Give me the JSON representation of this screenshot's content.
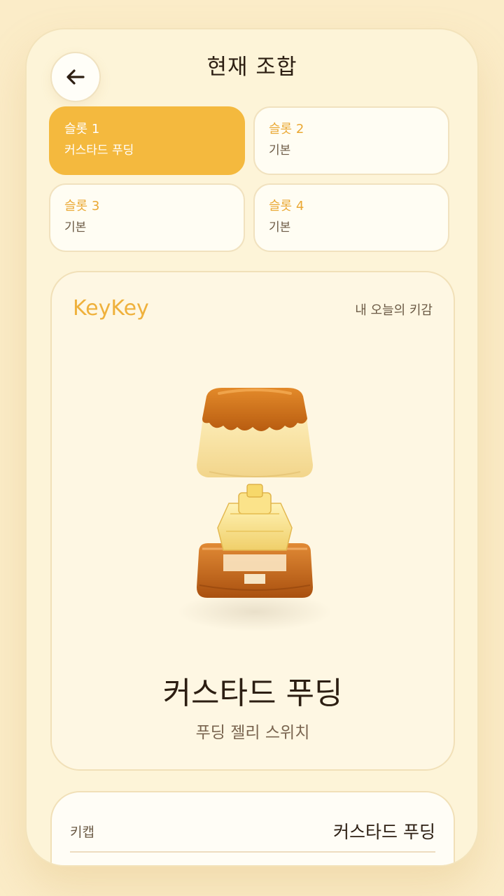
{
  "header": {
    "title": "현재 조합",
    "back_icon": "arrow-left-icon"
  },
  "slots": [
    {
      "name": "슬롯 1",
      "value": "커스타드 푸딩",
      "active": true
    },
    {
      "name": "슬롯 2",
      "value": "기본",
      "active": false
    },
    {
      "name": "슬롯 3",
      "value": "기본",
      "active": false
    },
    {
      "name": "슬롯 4",
      "value": "기본",
      "active": false
    }
  ],
  "combo": {
    "brand": "KeyKey",
    "mood": "내 오늘의 키감",
    "illustration": "pudding-keycap-switch-icon",
    "name": "커스타드 푸딩",
    "subtitle": "푸딩 젤리 스위치"
  },
  "details": {
    "keycap_label": "키캡",
    "keycap_value": "커스타드 푸딩"
  },
  "colors": {
    "accent": "#f4b93e",
    "background": "#fdf4d8",
    "text": "#2c1e12"
  }
}
